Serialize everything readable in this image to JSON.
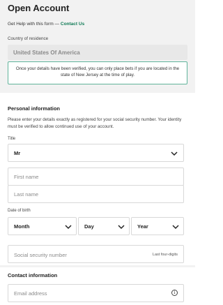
{
  "page": {
    "title": "Open Account",
    "help_text": "Get Help with this form —",
    "help_link": "Contact Us"
  },
  "residence": {
    "label": "Country of residence",
    "value": "United States Of America",
    "notice": "Once your details have been verified, you can only place bets if you are located in the state of New Jersey at the time of play."
  },
  "personal": {
    "heading": "Personal information",
    "info": "Please enter your details exactly as registered for your social security number. Your identity must be verified to allow continued use of your account.",
    "title_label": "Title",
    "title_value": "Mr",
    "first_name_placeholder": "First name",
    "last_name_placeholder": "Last name",
    "dob_label": "Date of birth",
    "dob_month": "Month",
    "dob_day": "Day",
    "dob_year": "Year",
    "ssn_placeholder": "Social security number",
    "ssn_hint": "Last four-digits"
  },
  "contact": {
    "heading": "Contact information",
    "email_placeholder": "Email address",
    "info_icon": "i"
  },
  "icons": {
    "chevron": "chevron-down-icon",
    "info": "info-icon"
  }
}
